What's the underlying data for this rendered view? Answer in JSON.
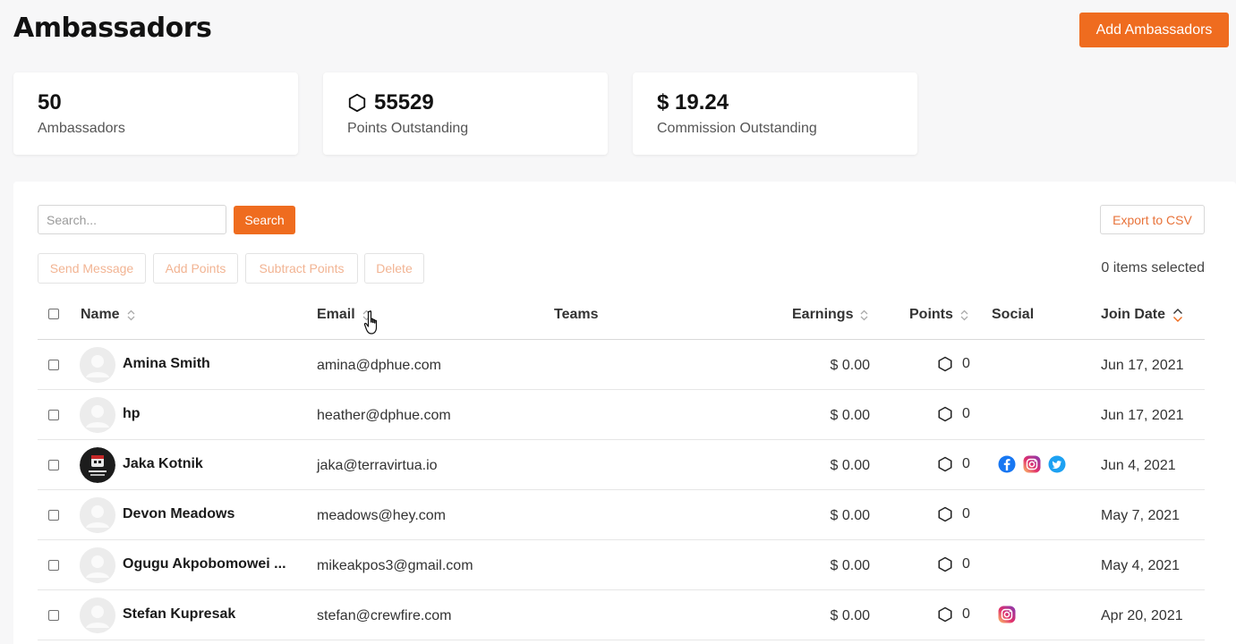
{
  "page": {
    "title": "Ambassadors",
    "add_button": "Add Ambassadors"
  },
  "stats": [
    {
      "value": "50",
      "label": "Ambassadors",
      "icon": ""
    },
    {
      "value": "55529",
      "label": "Points Outstanding",
      "icon": "hexagon-icon"
    },
    {
      "value": "$ 19.24",
      "label": "Commission Outstanding",
      "icon": ""
    }
  ],
  "toolbar": {
    "search_placeholder": "Search...",
    "search_button": "Search",
    "export_button": "Export to CSV",
    "actions": [
      "Send Message",
      "Add Points",
      "Subtract Points",
      "Delete"
    ],
    "selected_text": "0 items selected"
  },
  "table": {
    "columns": [
      "Name",
      "Email",
      "Teams",
      "Earnings",
      "Points",
      "Social",
      "Join Date"
    ],
    "rows": [
      {
        "name": "Amina Smith",
        "email": "amina@dphue.com",
        "team": "",
        "earnings": "$ 0.00",
        "points": "0",
        "social": [],
        "join_date": "Jun 17, 2021",
        "avatar": "default"
      },
      {
        "name": "hp",
        "email": "heather@dphue.com",
        "team": "",
        "earnings": "$ 0.00",
        "points": "0",
        "social": [],
        "join_date": "Jun 17, 2021",
        "avatar": "default"
      },
      {
        "name": "Jaka Kotnik",
        "email": "jaka@terravirtua.io",
        "team": "",
        "earnings": "$ 0.00",
        "points": "0",
        "social": [
          "facebook-icon",
          "instagram-icon",
          "twitter-icon"
        ],
        "join_date": "Jun 4, 2021",
        "avatar": "custom"
      },
      {
        "name": "Devon Meadows",
        "email": "meadows@hey.com",
        "team": "",
        "earnings": "$ 0.00",
        "points": "0",
        "social": [],
        "join_date": "May 7, 2021",
        "avatar": "default"
      },
      {
        "name": "Ogugu Akpobomowei ...",
        "email": "mikeakpos3@gmail.com",
        "team": "",
        "earnings": "$ 0.00",
        "points": "0",
        "social": [],
        "join_date": "May 4, 2021",
        "avatar": "default"
      },
      {
        "name": "Stefan Kupresak",
        "email": "stefan@crewfire.com",
        "team": "",
        "earnings": "$ 0.00",
        "points": "0",
        "social": [
          "instagram-icon"
        ],
        "join_date": "Apr 20, 2021",
        "avatar": "default"
      }
    ]
  },
  "colors": {
    "accent": "#ef6c1f",
    "muted_accent": "#f2b493"
  }
}
